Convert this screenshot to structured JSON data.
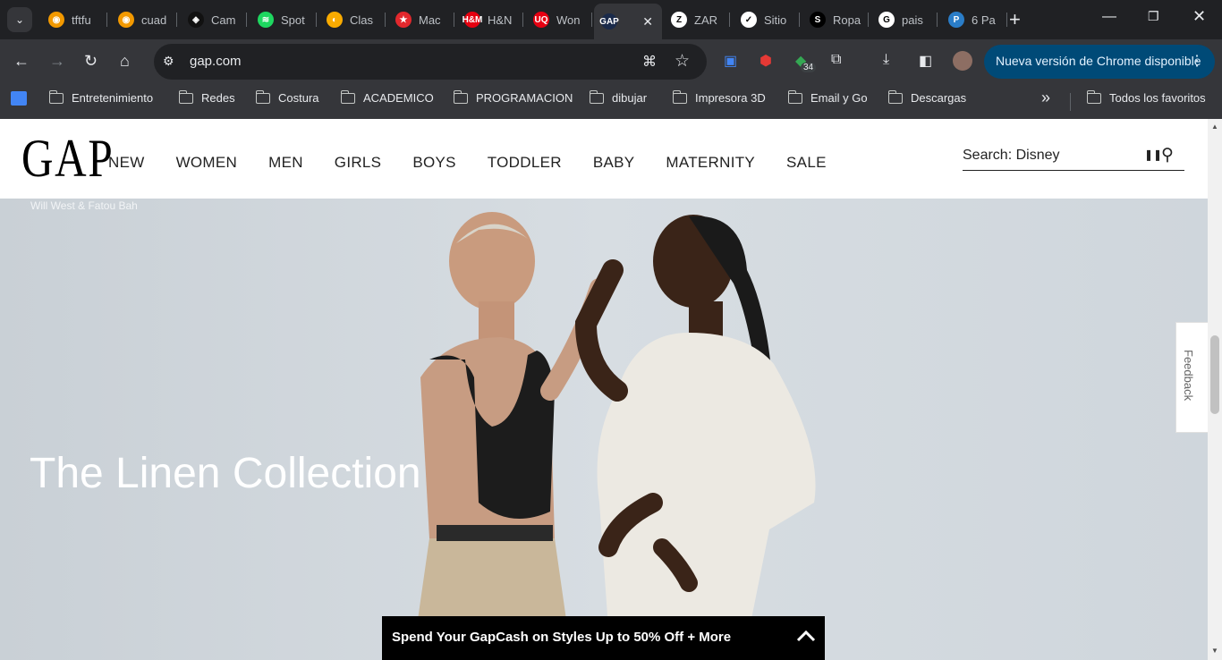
{
  "browser": {
    "tabs": [
      {
        "label": "tftfu",
        "color": "#f29900",
        "glyph": "◉"
      },
      {
        "label": "cuad",
        "color": "#f29900",
        "glyph": "◉"
      },
      {
        "label": "Cam",
        "color": "#111111",
        "glyph": "◈"
      },
      {
        "label": "Spot",
        "color": "#1ed760",
        "glyph": "≋"
      },
      {
        "label": "Clas",
        "color": "#f9ab00",
        "glyph": "◐"
      },
      {
        "label": "Mac",
        "color": "#e2282d",
        "glyph": "★"
      },
      {
        "label": "H&N",
        "color": "#e50010",
        "glyph": "H&M"
      },
      {
        "label": "Won",
        "color": "#e60012",
        "glyph": "UQ"
      },
      {
        "label": "",
        "color": "#1a2a4a",
        "glyph": "GAP"
      },
      {
        "label": "ZAR",
        "color": "#ffffff",
        "glyph": "Z"
      },
      {
        "label": "Sitio",
        "color": "#ffffff",
        "glyph": "✓"
      },
      {
        "label": "Ropa",
        "color": "#000000",
        "glyph": "S"
      },
      {
        "label": "pais",
        "color": "#ffffff",
        "glyph": "G"
      },
      {
        "label": "6 Pa",
        "color": "#2a7dc8",
        "glyph": "P"
      }
    ],
    "active_tab_index": 8,
    "new_tab_label": "+",
    "url": "gap.com",
    "extension_badge": "34",
    "update_label": "Nueva versión de Chrome disponible",
    "bookmarks": [
      "Entretenimiento",
      "Redes",
      "Costura",
      "ACADEMICO",
      "PROGRAMACION",
      "dibujar",
      "Impresora 3D",
      "Email y Go",
      "Descargas"
    ],
    "all_bookmarks_label": "Todos los favoritos",
    "more_bookmarks": "»"
  },
  "site": {
    "logo": "GAP",
    "nav": [
      "NEW",
      "WOMEN",
      "MEN",
      "GIRLS",
      "BOYS",
      "TODDLER",
      "BABY",
      "MATERNITY",
      "SALE"
    ],
    "search_text": "Search: Disney",
    "hero_credit": "Will West & Fatou Bah",
    "hero_title": "The Linen Collection",
    "feedback_label": "Feedback",
    "promo_text": "Spend Your GapCash on Styles Up to 50% Off + More"
  },
  "colors": {
    "accent": "#004a77",
    "promo_bg": "#000000",
    "hero_bg": "#d3d9de"
  }
}
